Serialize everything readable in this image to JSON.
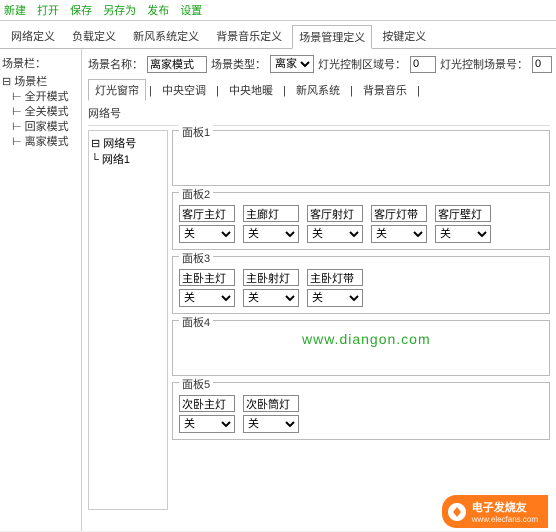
{
  "menubar": {
    "items": [
      "新建",
      "打开",
      "保存",
      "另存为",
      "发布",
      "设置"
    ]
  },
  "tabs": {
    "items": [
      "网络定义",
      "负载定义",
      "新风系统定义",
      "背景音乐定义",
      "场景管理定义",
      "按键定义"
    ],
    "active_index": 4
  },
  "left": {
    "title": "场景栏：",
    "root": "场景栏",
    "children": [
      "全开模式",
      "全关模式",
      "回家模式",
      "离家模式"
    ]
  },
  "form": {
    "name_label": "场景名称：",
    "name_value": "离家模式",
    "type_label": "场景类型：",
    "type_value": "离家",
    "zone_label": "灯光控制区域号：",
    "zone_value": "0",
    "scene_label": "灯光控制场景号：",
    "scene_value": "0"
  },
  "subtabs": {
    "items": [
      "灯光窗帘",
      "中央空调",
      "中央地暖",
      "新风系统",
      "背景音乐"
    ],
    "active_index": 0
  },
  "network_label": "网络号",
  "subtree": {
    "root": "网络号",
    "child": "网络1"
  },
  "panels": [
    {
      "legend": "面板1",
      "empty": true
    },
    {
      "legend": "面板2",
      "empty": false,
      "controls": [
        {
          "name": "客厅主灯",
          "value": "关"
        },
        {
          "name": "主廊灯",
          "value": "关"
        },
        {
          "name": "客厅射灯",
          "value": "关"
        },
        {
          "name": "客厅灯带",
          "value": "关"
        },
        {
          "name": "客厅壁灯",
          "value": "关"
        }
      ]
    },
    {
      "legend": "面板3",
      "empty": false,
      "controls": [
        {
          "name": "主卧主灯",
          "value": "关"
        },
        {
          "name": "主卧射灯",
          "value": "关"
        },
        {
          "name": "主卧灯带",
          "value": "关"
        }
      ]
    },
    {
      "legend": "面板4",
      "empty": true
    },
    {
      "legend": "面板5",
      "empty": false,
      "controls": [
        {
          "name": "次卧主灯",
          "value": "关"
        },
        {
          "name": "次卧筒灯",
          "value": "关"
        }
      ]
    }
  ],
  "watermark": "www.diangon.com",
  "footer": {
    "brand": "电子发烧友",
    "sub": "www.elecfans.com"
  }
}
